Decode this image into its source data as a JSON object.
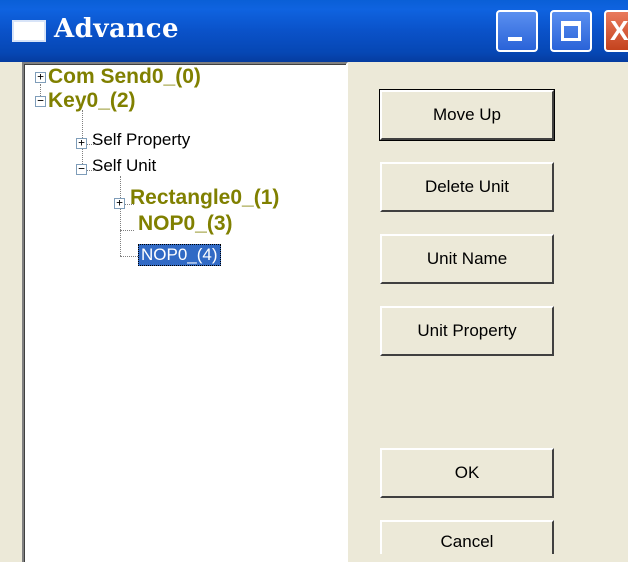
{
  "window": {
    "title": "Advance",
    "minimize_glyph": "_",
    "close_glyph": "X"
  },
  "tree": {
    "nodes": [
      {
        "label": "Com Send0_(0)",
        "expander": "+",
        "style": "bold"
      },
      {
        "label": "Key0_(2)",
        "expander": "−",
        "style": "bold"
      },
      {
        "label": "Self Property",
        "expander": "+",
        "style": "normal"
      },
      {
        "label": "Self Unit",
        "expander": "−",
        "style": "normal"
      },
      {
        "label": "Rectangle0_(1)",
        "expander": "+",
        "style": "bold"
      },
      {
        "label": "NOP0_(3)",
        "style": "bold"
      },
      {
        "label": "NOP0_(4)",
        "style": "selected"
      }
    ]
  },
  "buttons": {
    "move_up": "Move Up",
    "delete_unit": "Delete Unit",
    "unit_name": "Unit Name",
    "unit_property": "Unit Property",
    "ok": "OK",
    "cancel": "Cancel"
  },
  "colors": {
    "titlebar": "#0a52c9",
    "dialog_bg": "#ece9d8",
    "bold_node_text": "#808000",
    "selection_bg": "#316ac5"
  }
}
